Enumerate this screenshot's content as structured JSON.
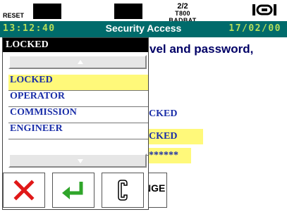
{
  "top": {
    "reset_label": "RESET",
    "page": "2/2",
    "device": "T800 BADBAT"
  },
  "titlebar": {
    "time": "13:12:40",
    "title": "Security Access",
    "date": "17/02/00"
  },
  "background": {
    "instruction": "vel and password,",
    "level_value": "CKED",
    "highlight_value": "CKED",
    "password_masked": "******",
    "button_label": "NGE"
  },
  "popup": {
    "header": "LOCKED",
    "options": [
      "LOCKED",
      "OPERATOR",
      "COMMISSION",
      "ENGINEER"
    ],
    "selected_index": 0
  },
  "colors": {
    "titlebar": "#006b6b",
    "clock": "#b6dd5a",
    "highlight": "#fff97a",
    "list_text": "#1a2ea8",
    "cancel": "#e01818",
    "enter": "#2fa52a"
  },
  "icons": {
    "cancel": "x-icon",
    "enter": "enter-arrow-icon",
    "clear": "clear-c-icon",
    "status": "battery-signal-icon"
  }
}
